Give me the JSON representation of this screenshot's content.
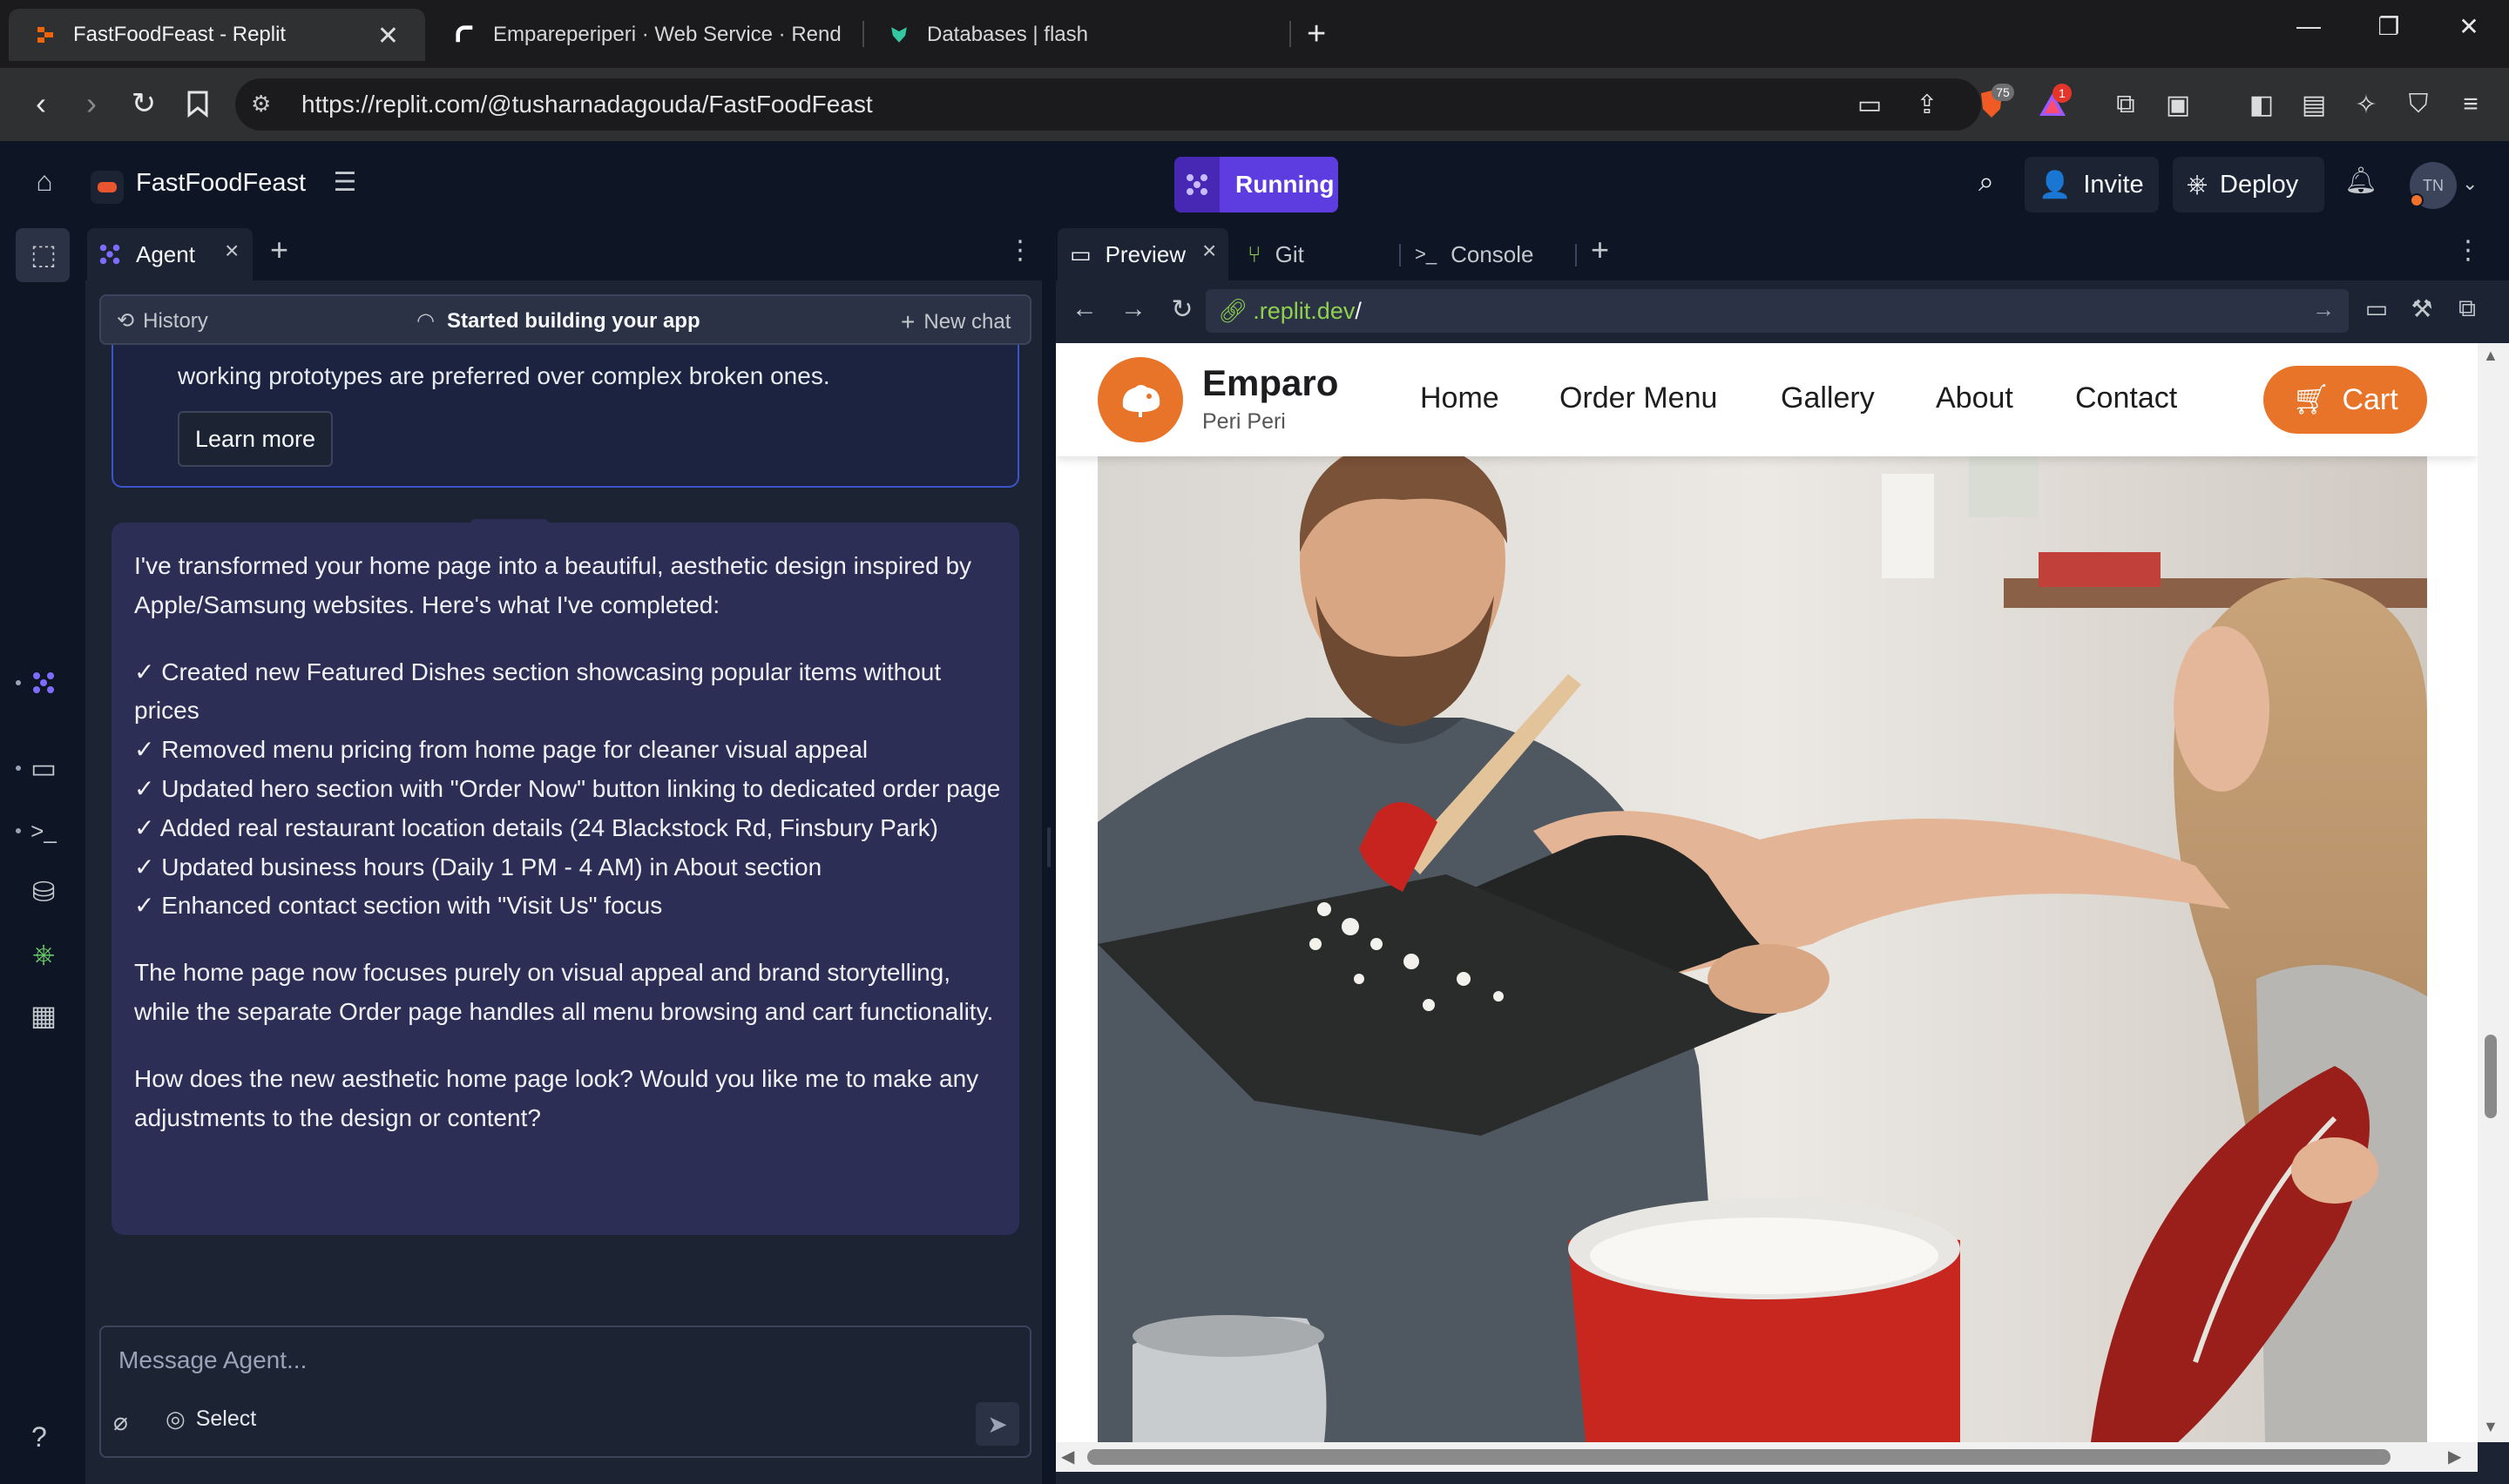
{
  "browser": {
    "tabs": [
      {
        "title": "FastFoodFeast - Replit",
        "icon": "replit-icon"
      },
      {
        "title": "Empareperiperi · Web Service · Rend",
        "icon": "render-icon"
      },
      {
        "title": "Databases | flash",
        "icon": "database-icon"
      }
    ],
    "url": "https://replit.com/@tusharnadagouda/FastFoodFeast",
    "shield_badge": "75",
    "alert_badge": "1"
  },
  "replit": {
    "project_name": "FastFoodFeast",
    "run_label": "Running",
    "invite_label": "Invite",
    "deploy_label": "Deploy",
    "avatar_initials": "TN",
    "accent": "#5e3de0"
  },
  "agent": {
    "tab_label": "Agent",
    "history_label": "History",
    "status_label": "Started building your app",
    "new_chat_label": "New chat",
    "info_text": "working prototypes are preferred over complex broken ones.",
    "learn_more_label": "Learn more",
    "message": {
      "intro": "I've transformed your home page into a beautiful, aesthetic design inspired by Apple/Samsung websites. Here's what I've completed:",
      "items": [
        "✓ Created new Featured Dishes section showcasing popular items without prices",
        "✓ Removed menu pricing from home page for cleaner visual appeal",
        "✓ Updated hero section with \"Order Now\" button linking to dedicated order page",
        "✓ Added real restaurant location details (24 Blackstock Rd, Finsbury Park)",
        "✓ Updated business hours (Daily 1 PM - 4 AM) in About section",
        "✓ Enhanced contact section with \"Visit Us\" focus"
      ],
      "summary": "The home page now focuses purely on visual appeal and brand storytelling, while the separate Order page handles all menu browsing and cart functionality.",
      "question": "How does the new aesthetic home page look? Would you like me to make any adjustments to the design or content?"
    },
    "input_placeholder": "Message Agent...",
    "select_label": "Select"
  },
  "preview": {
    "tabs": [
      {
        "label": "Preview"
      },
      {
        "label": "Git"
      },
      {
        "label": "Console"
      }
    ],
    "url_host": ".replit.dev",
    "url_path": "/"
  },
  "site": {
    "brand": "Emparo",
    "tagline": "Peri Peri",
    "nav": [
      "Home",
      "Order Menu",
      "Gallery",
      "About",
      "Contact"
    ],
    "cart_label": "Cart",
    "accent": "#e8742a"
  }
}
